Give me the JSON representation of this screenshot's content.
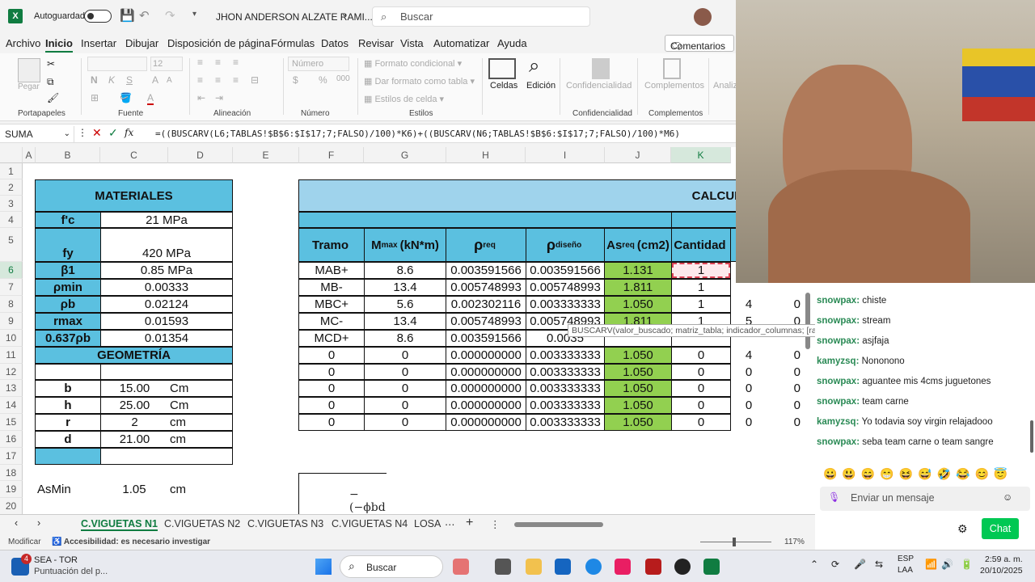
{
  "titlebar": {
    "autosave": "Autoguardado",
    "doc_title": "JHON ANDERSON ALZATE RAMI...",
    "search_placeholder": "Buscar"
  },
  "menu": [
    "Archivo",
    "Inicio",
    "Insertar",
    "Dibujar",
    "Disposición de página",
    "Fórmulas",
    "Datos",
    "Revisar",
    "Vista",
    "Automatizar",
    "Ayuda"
  ],
  "comments_btn": "Comentarios",
  "ribbon": {
    "paste": "Pegar",
    "portapapeles": "Portapapeles",
    "font_size": "12",
    "fuente": "Fuente",
    "alineacion": "Alineación",
    "number_format": "Número",
    "numero": "Número",
    "cond_format": "Formato condicional",
    "table_format": "Dar formato como tabla",
    "cell_styles": "Estilos de celda",
    "estilos": "Estilos",
    "celdas": "Celdas",
    "edicion": "Edición",
    "confidencialidad": "Confidencialidad",
    "complementos": "Complementos",
    "analizar": "Analizar datos"
  },
  "formula_bar": {
    "name_box": "SUMA",
    "fx": "fx",
    "formula": "=((BUSCARV(L6;TABLAS!$B$6:$I$17;7;FALSO)/100)*K6)+((BUSCARV(N6;TABLAS!$B$6:$I$17;7;FALSO)/100)*M6)"
  },
  "columns": [
    "A",
    "B",
    "C",
    "D",
    "E",
    "F",
    "G",
    "H",
    "I",
    "J",
    "K"
  ],
  "rows": [
    "1",
    "2",
    "3",
    "4",
    "5",
    "6",
    "7",
    "8",
    "9",
    "10",
    "11",
    "12",
    "13",
    "14",
    "15",
    "16",
    "17",
    "18",
    "19",
    "20"
  ],
  "materiales": {
    "title": "MATERIALES",
    "items": [
      {
        "label": "f'c",
        "value": "21 MPa"
      },
      {
        "label": "fy",
        "value": "420 MPa"
      },
      {
        "label": "β1",
        "value": "0.85 MPa"
      },
      {
        "label": "ρmin",
        "value": "0.00333"
      },
      {
        "label": "ρb",
        "value": "0.02124"
      },
      {
        "label": "rmax",
        "value": "0.01593"
      },
      {
        "label": "0.637ρb",
        "value": "0.01354"
      }
    ]
  },
  "geometria": {
    "title": "GEOMETRÍA",
    "items": [
      {
        "label": "b",
        "value": "15.00",
        "unit": "Cm"
      },
      {
        "label": "h",
        "value": "25.00",
        "unit": "Cm"
      },
      {
        "label": "r",
        "value": "2",
        "unit": "cm"
      },
      {
        "label": "d",
        "value": "21.00",
        "unit": "cm"
      }
    ]
  },
  "asmin": {
    "label": "AsMin",
    "value": "1.05",
    "unit": "cm"
  },
  "calculo": {
    "title": "CALCULO DE REFU",
    "headers": [
      "Tramo",
      "M",
      "ρ",
      "ρ",
      "As",
      "Cantidad"
    ],
    "header_subs": [
      "",
      "max",
      "req",
      "diseño",
      "req",
      ""
    ],
    "header_units": [
      "",
      "(kN*m)",
      "",
      "",
      "(cm2)",
      ""
    ],
    "rows": [
      [
        "MAB+",
        "8.6",
        "0.003591566",
        "0.003591566",
        "1.131",
        "1",
        "",
        ""
      ],
      [
        "MB-",
        "13.4",
        "0.005748993",
        "0.005748993",
        "1.811",
        "1",
        "",
        ""
      ],
      [
        "MBC+",
        "5.6",
        "0.002302116",
        "0.003333333",
        "1.050",
        "1",
        "4",
        "0"
      ],
      [
        "MC-",
        "13.4",
        "0.005748993",
        "0.005748993",
        "1.811",
        "1",
        "5",
        "0"
      ],
      [
        "MCD+",
        "8.6",
        "0.003591566",
        "0.0035",
        "",
        "",
        "",
        ""
      ],
      [
        "0",
        "0",
        "0.000000000",
        "0.003333333",
        "1.050",
        "0",
        "4",
        "0"
      ],
      [
        "0",
        "0",
        "0.000000000",
        "0.003333333",
        "1.050",
        "0",
        "0",
        "0"
      ],
      [
        "0",
        "0",
        "0.000000000",
        "0.003333333",
        "1.050",
        "0",
        "0",
        "0"
      ],
      [
        "0",
        "0",
        "0.000000000",
        "0.003333333",
        "1.050",
        "0",
        "0",
        "0"
      ],
      [
        "0",
        "0",
        "0.000000000",
        "0.003333333",
        "1.050",
        "0",
        "0",
        "0"
      ]
    ]
  },
  "tooltip": "BUSCARV(valor_buscado; matriz_tabla; indicador_columnas; [rango])",
  "formula_fragment": "−(−ϕbd",
  "sheet_tabs": [
    "C.VIGUETAS N1",
    "C.VIGUETAS N2",
    "C.VIGUETAS N3",
    "C.VIGUETAS N4",
    "LOSA"
  ],
  "status": {
    "mode": "Modificar",
    "accessibility": "Accesibilidad: es necesario investigar",
    "zoom": "117%"
  },
  "chat": {
    "messages": [
      {
        "user": "snowpax",
        "text": "chiste"
      },
      {
        "user": "snowpax",
        "text": "stream"
      },
      {
        "user": "snowpax",
        "text": "asjfaja"
      },
      {
        "user": "kamyzsq",
        "text": "Nononono"
      },
      {
        "user": "snowpax",
        "text": "aguantee mis 4cms juguetones"
      },
      {
        "user": "snowpax",
        "text": "team carne"
      },
      {
        "user": "kamyzsq",
        "text": "Yo todavia soy virgin relajadooo"
      },
      {
        "user": "snowpax",
        "text": "seba team carne o team sangre"
      }
    ],
    "input_placeholder": "Enviar un mensaje",
    "chat_button": "Chat"
  },
  "taskbar": {
    "app_name": "SEA - TOR",
    "app_sub": "Puntuación del p...",
    "badge": "4",
    "search": "Buscar",
    "lang1": "ESP",
    "lang2": "LAA",
    "time": "2:59 a. m.",
    "date": "20/10/2025"
  },
  "colors": {
    "excel_green": "#107c41",
    "header_blue": "#5bc0e0",
    "as_green": "#92d050",
    "chat_button": "#00c853"
  }
}
